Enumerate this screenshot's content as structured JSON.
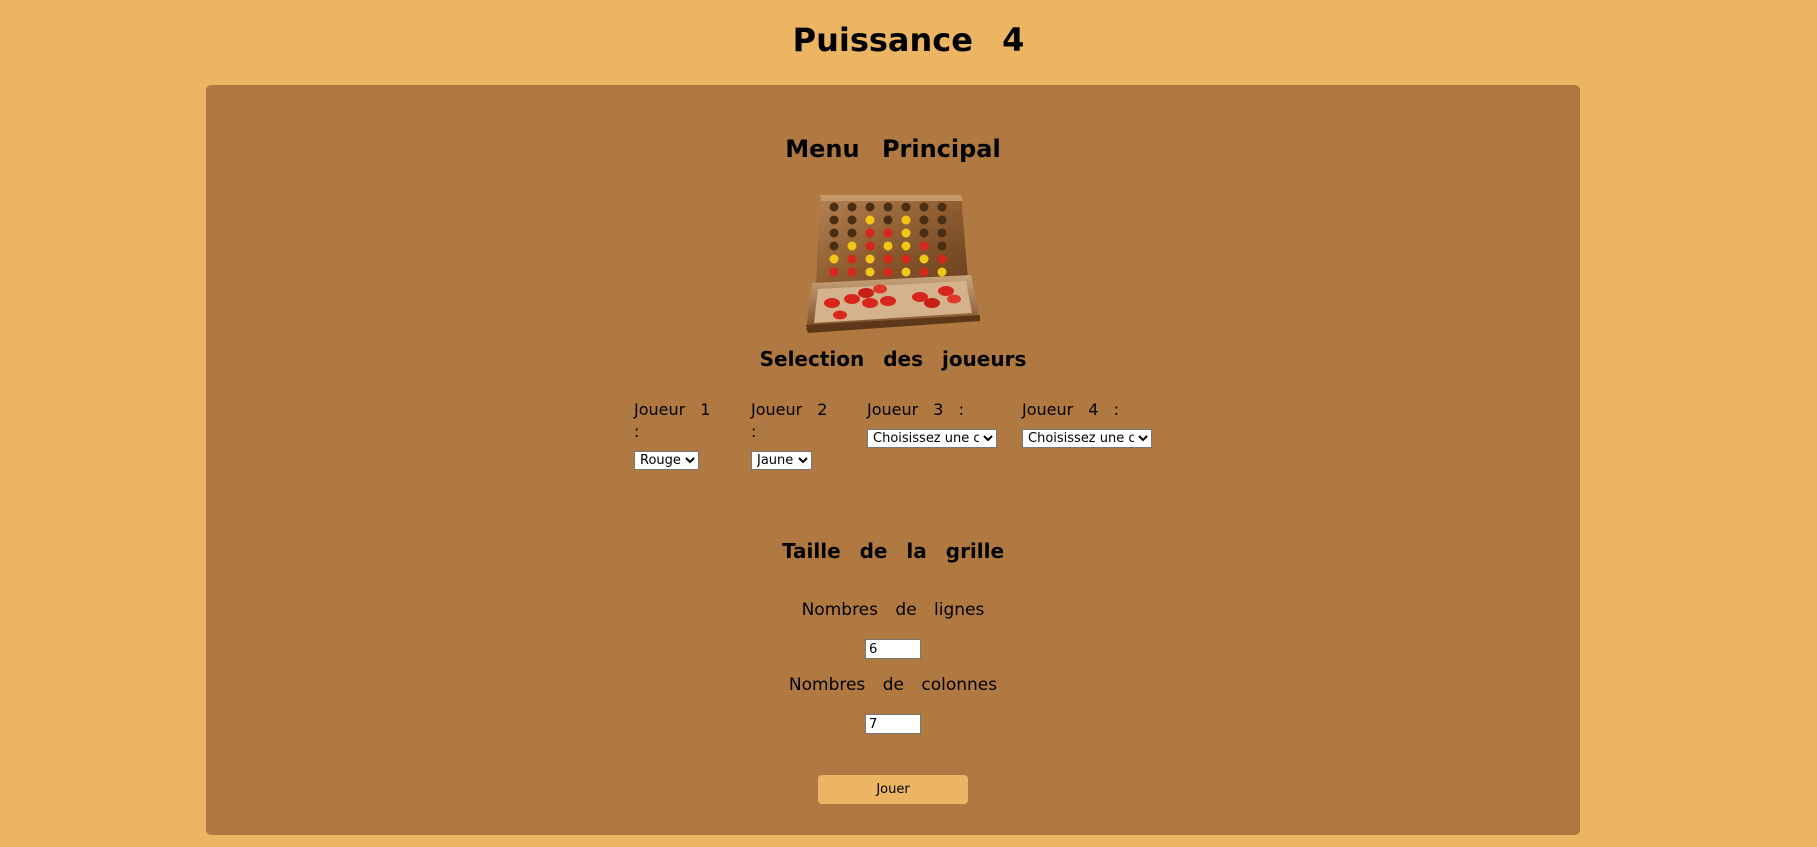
{
  "header": {
    "title": "Puissance 4"
  },
  "menu": {
    "title": "Menu Principal",
    "image_alt": "connect-four-board"
  },
  "players": {
    "title": "Selection des joueurs",
    "items": [
      {
        "label": "Joueur 1 :",
        "selected": "Rouge"
      },
      {
        "label": "Joueur 2 :",
        "selected": "Jaune"
      },
      {
        "label": "Joueur 3 :",
        "selected": "Choisissez une co"
      },
      {
        "label": "Joueur 4 :",
        "selected": "Choisissez une co"
      }
    ]
  },
  "grid": {
    "title": "Taille de la grille",
    "rows_label": "Nombres de lignes",
    "rows_value": "6",
    "cols_label": "Nombres de colonnes",
    "cols_value": "7"
  },
  "actions": {
    "play_label": "Jouer"
  },
  "colors": {
    "page_background": "#ebb564",
    "panel_background": "#b07941",
    "red_token": "#d8261c",
    "yellow_token": "#f1c615",
    "wood": "#8b5a2b"
  }
}
